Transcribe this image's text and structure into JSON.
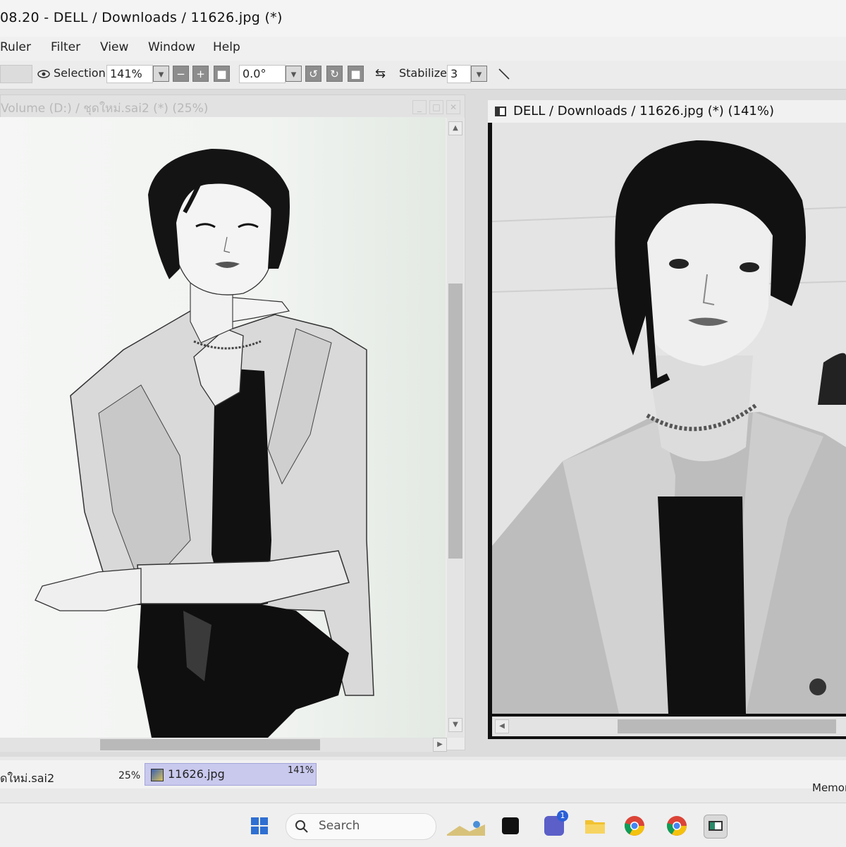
{
  "window_title": "08.20 - DELL / Downloads / 11626.jpg (*)",
  "menu": {
    "items": [
      "Ruler",
      "Filter",
      "View",
      "Window",
      "Help"
    ]
  },
  "toolbar": {
    "selection_label": "Selection",
    "zoom_value": "141%",
    "rotation_value": "0.0°",
    "stabilizer_label": "Stabilizer",
    "stabilizer_value": "3"
  },
  "canvas_left": {
    "title": "Volume (D:) / ชุดใหม่.sai2 (*) (25%)"
  },
  "canvas_right": {
    "title": "DELL / Downloads / 11626.jpg (*) (141%)"
  },
  "doc_tabs": [
    {
      "name": "ดใหม่.sai2",
      "zoom": "25%"
    },
    {
      "name": "11626.jpg",
      "zoom": "141%"
    }
  ],
  "status": {
    "memory_label": "Memor"
  },
  "taskbar": {
    "search_placeholder": "Search",
    "icons": [
      "windows-start-icon",
      "search-icon",
      "widgets-icon",
      "app-icon",
      "teams-icon",
      "file-explorer-icon",
      "chrome-icon",
      "chrome-icon",
      "paint-tool-sai-icon"
    ],
    "teams_badge": "1"
  },
  "colors": {
    "tab_active": "#c9c9ee",
    "scrollbar_thumb": "#b9b9b9"
  }
}
